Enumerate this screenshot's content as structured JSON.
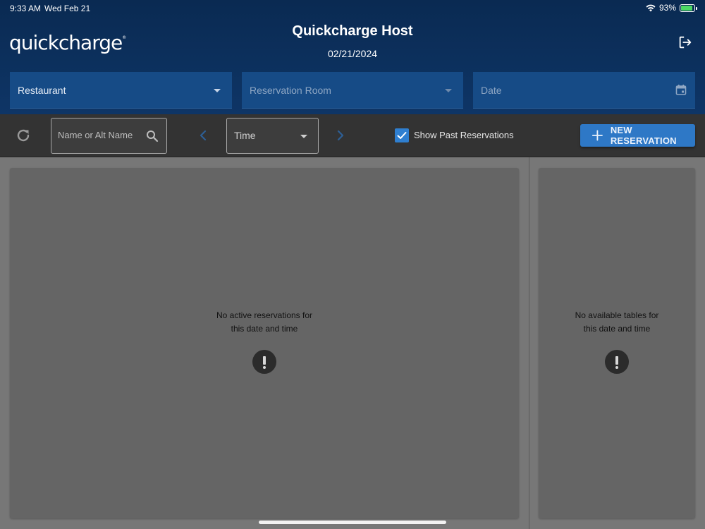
{
  "status_bar": {
    "time": "9:33 AM",
    "date": "Wed Feb 21",
    "battery": "93%",
    "battery_level": 0.93
  },
  "header": {
    "logo": "quickcharge",
    "logo_mark": "®",
    "title": "Quickcharge Host",
    "date": "02/21/2024"
  },
  "filters": {
    "restaurant": "Restaurant",
    "room": "Reservation Room",
    "date": "Date"
  },
  "toolbar": {
    "search_placeholder": "Name or Alt Name",
    "time_label": "Time",
    "show_past_label": "Show Past Reservations",
    "show_past_checked": true,
    "new_reservation_label": "NEW RESERVATION"
  },
  "reservations_panel": {
    "empty_line1": "No active reservations for",
    "empty_line2": "this date and time"
  },
  "tables_panel": {
    "empty_line1": "No available tables for",
    "empty_line2": "this date and time"
  },
  "colors": {
    "header_bg": "#0e3566",
    "field_bg": "#164b86",
    "toolbar_bg": "#333333",
    "accent": "#2e78c6",
    "content_bg": "#777777",
    "panel_bg": "#656565"
  }
}
